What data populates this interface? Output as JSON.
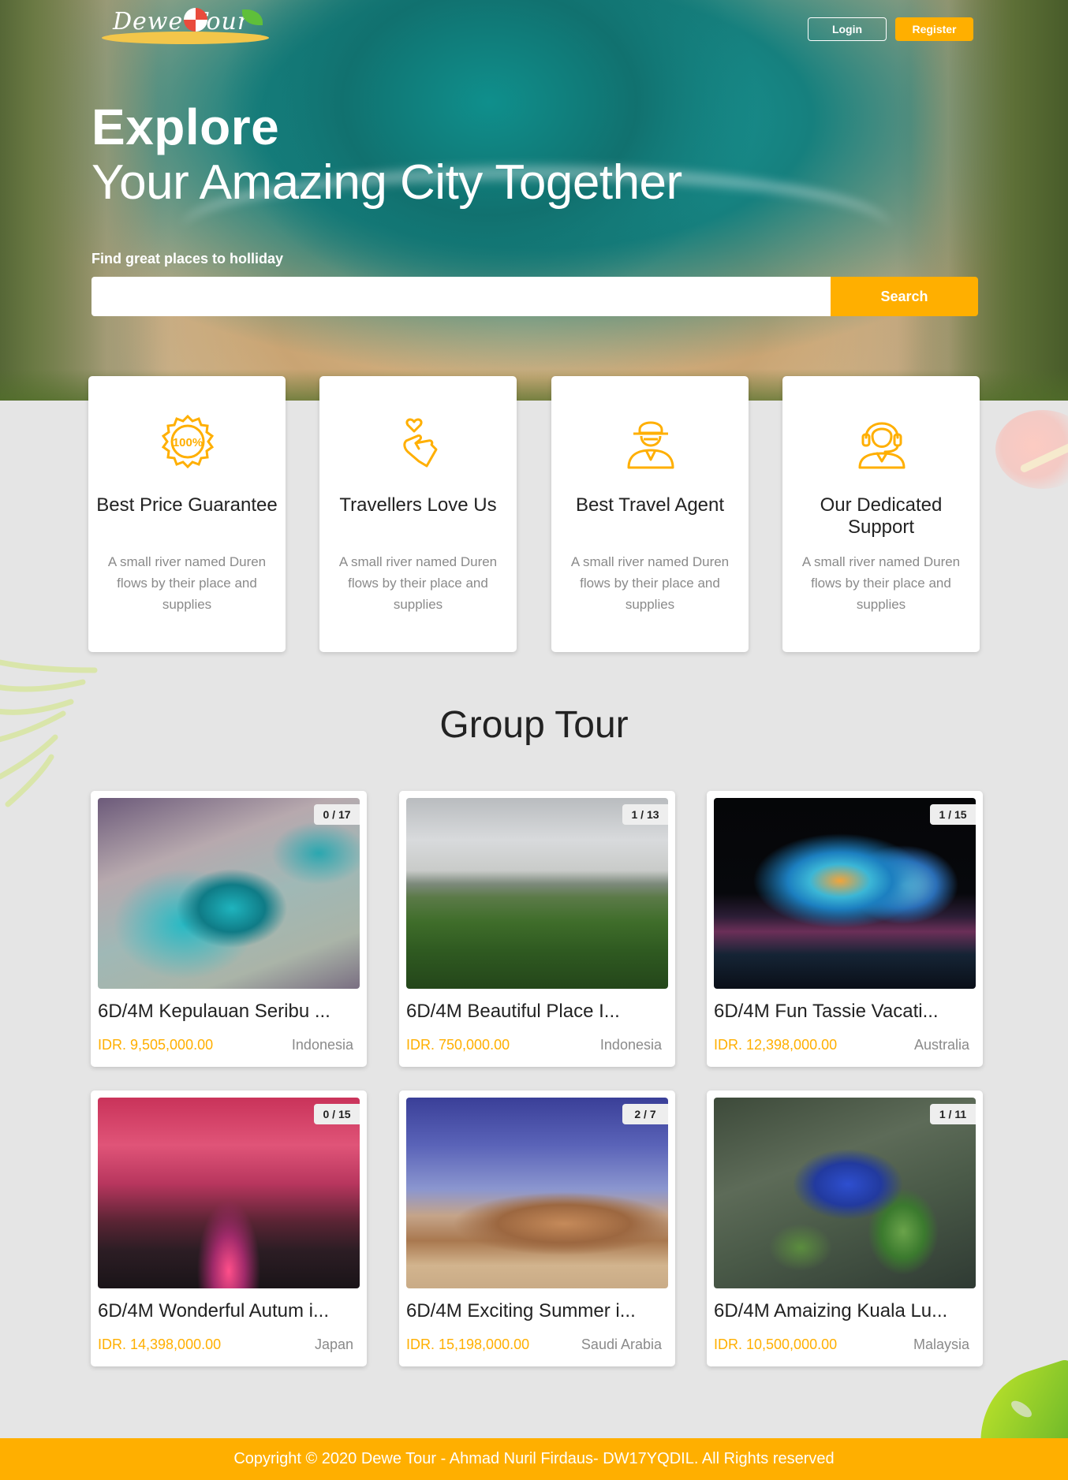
{
  "colors": {
    "accent": "#FFAF00",
    "background": "#E5E5E5",
    "muted_text": "#8a8a8a"
  },
  "nav": {
    "logo_text": "Dewe Tour",
    "login_label": "Login",
    "register_label": "Register"
  },
  "hero": {
    "title": "Explore",
    "subtitle": "Your Amazing City Together",
    "search_label": "Find great places to holliday",
    "search_value": "",
    "search_button": "Search"
  },
  "features": [
    {
      "icon": "badge-100-percent-icon",
      "title": "Best Price Guarantee",
      "desc": "A small river named Duren flows by their place and supplies"
    },
    {
      "icon": "finger-heart-icon",
      "title": "Travellers Love Us",
      "desc": "A small river named Duren flows by their place and supplies"
    },
    {
      "icon": "agent-icon",
      "title": "Best Travel Agent",
      "desc": "A small river named Duren flows by their place and supplies"
    },
    {
      "icon": "support-headset-icon",
      "title": "Our Dedicated Support",
      "desc": "A small river named Duren flows by their place and supplies"
    }
  ],
  "group_tour": {
    "title": "Group Tour",
    "tours": [
      {
        "quota": "0 / 17",
        "title": "6D/4M Kepulauan Seribu ...",
        "price": "IDR. 9,505,000.00",
        "country": "Indonesia"
      },
      {
        "quota": "1 / 13",
        "title": "6D/4M Beautiful Place I...",
        "price": "IDR. 750,000.00",
        "country": "Indonesia"
      },
      {
        "quota": "1 / 15",
        "title": "6D/4M Fun Tassie Vacati...",
        "price": "IDR. 12,398,000.00",
        "country": "Australia"
      },
      {
        "quota": "0 / 15",
        "title": "6D/4M Wonderful Autum i...",
        "price": "IDR. 14,398,000.00",
        "country": "Japan"
      },
      {
        "quota": "2 / 7",
        "title": "6D/4M Exciting Summer i...",
        "price": "IDR. 15,198,000.00",
        "country": "Saudi Arabia"
      },
      {
        "quota": "1 / 11",
        "title": "6D/4M Amaizing Kuala Lu...",
        "price": "IDR. 10,500,000.00",
        "country": "Malaysia"
      }
    ]
  },
  "footer": {
    "text": "Copyright © 2020 Dewe Tour - Ahmad Nuril Firdaus- DW17YQDIL. All Rights reserved"
  }
}
